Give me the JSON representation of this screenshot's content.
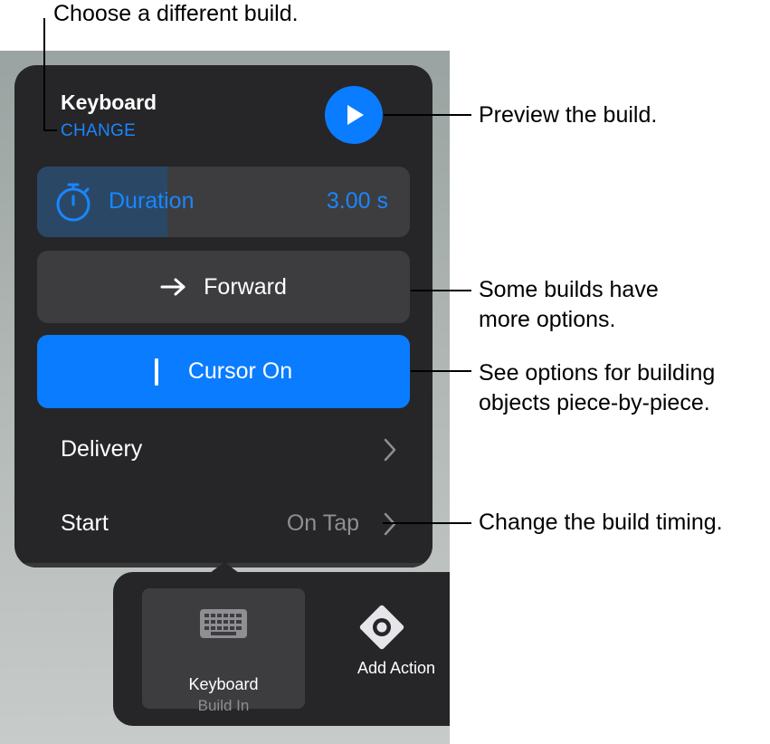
{
  "panel": {
    "title": "Keyboard",
    "change_label": "CHANGE",
    "duration_label": "Duration",
    "duration_value": "3.00 s",
    "duration_fill_fraction": 0.35,
    "direction_label": "Forward",
    "cursor_label": "Cursor On",
    "rows": [
      {
        "label": "Delivery",
        "value": ""
      },
      {
        "label": "Start",
        "value": "On Tap"
      }
    ]
  },
  "tray": {
    "items": [
      {
        "label": "Keyboard",
        "sublabel": "Build In"
      },
      {
        "label": "Add Action"
      }
    ]
  },
  "callouts": {
    "change": "Choose a different build.",
    "preview": "Preview the build.",
    "options_line1": "Some builds have",
    "options_line2": "more options.",
    "piece_line1": "See options for building",
    "piece_line2": "objects piece-by-piece.",
    "timing": "Change the build timing."
  },
  "colors": {
    "accent": "#0a7cff",
    "panel": "#262628",
    "control": "#3d3d40"
  },
  "icons": [
    "play-icon",
    "timer-icon",
    "arrow-right-icon",
    "cursor-icon",
    "chevron-right-icon",
    "keyboard-icon",
    "add-action-icon"
  ]
}
